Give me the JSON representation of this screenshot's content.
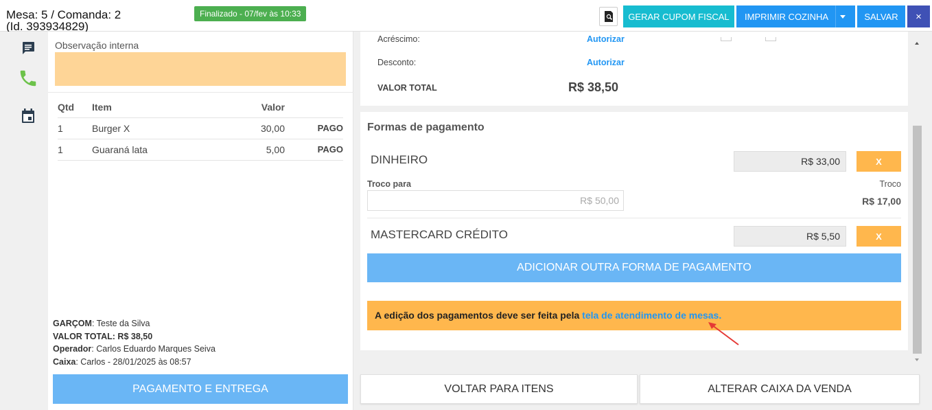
{
  "header": {
    "title_line1": "Mesa: 5 / Comanda: 2",
    "title_line2": "(Id. 393934829)",
    "status_badge": "Finalizado - 07/fev às 10:33",
    "buttons": {
      "gerar_cupom": "GERAR CUPOM FISCAL",
      "imprimir_cozinha": "IMPRIMIR COZINHA",
      "salvar": "SALVAR",
      "close": "×"
    }
  },
  "sidebar": {
    "icons": [
      "message-icon",
      "phone-icon",
      "calendar-icon"
    ]
  },
  "left": {
    "obs_label": "Observação interna",
    "obs_value": "",
    "table": {
      "headers": [
        "Qtd",
        "Item",
        "Valor",
        ""
      ],
      "rows": [
        {
          "qtd": "1",
          "item": "Burger X",
          "valor": "30,00",
          "status": "PAGO"
        },
        {
          "qtd": "1",
          "item": "Guaraná lata",
          "valor": "5,00",
          "status": "PAGO"
        }
      ]
    },
    "summary": {
      "garcom_label": "GARÇOM",
      "garcom_value": ": Teste da Silva",
      "valor_total_label": "VALOR TOTAL: R$ 38,50",
      "operador_label": "Operador",
      "operador_value": ": Carlos Eduardo Marques Seiva",
      "caixa_label": "Caixa",
      "caixa_value": ": Carlos - 28/01/2025 às 08:57"
    },
    "pagamento_entrega": "PAGAMENTO E ENTREGA"
  },
  "totals": {
    "acrescimo_label": "Acréscimo:",
    "acrescimo_action": "Autorizar",
    "desconto_label": "Desconto:",
    "desconto_action": "Autorizar",
    "valor_total_label": "VALOR TOTAL",
    "valor_total_value": "R$ 38,50"
  },
  "payments": {
    "title": "Formas de pagamento",
    "methods": [
      {
        "name": "DINHEIRO",
        "value": "R$ 33,00",
        "remove": "X"
      },
      {
        "name": "MASTERCARD CRÉDITO",
        "value": "R$ 5,50",
        "remove": "X"
      }
    ],
    "troco_para_label": "Troco para",
    "troco_para_value": "R$ 50,00",
    "troco_label": "Troco",
    "troco_value": "R$ 17,00",
    "add_button": "ADICIONAR OUTRA FORMA DE PAGAMENTO",
    "warning_text": "A edição dos pagamentos deve ser feita pela ",
    "warning_link": "tela de atendimento de mesas."
  },
  "footer": {
    "voltar": "VOLTAR PARA ITENS",
    "alterar": "ALTERAR CAIXA DA VENDA"
  },
  "colors": {
    "cyan": "#17bcd0",
    "blue": "#2196f3",
    "indigo": "#3f51b5",
    "green": "#4caf50",
    "orange": "#ffb74d",
    "light_blue": "#6ab6f5",
    "obs_bg": "#fed597"
  }
}
